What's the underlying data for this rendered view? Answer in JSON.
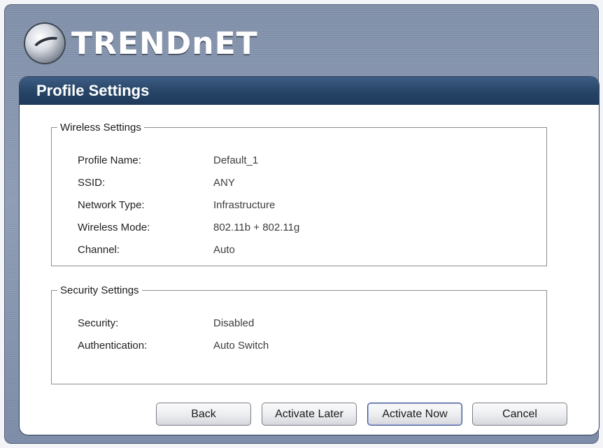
{
  "brand": {
    "logo_text": "TRENDnET"
  },
  "header": {
    "title": "Profile Settings"
  },
  "wireless": {
    "legend": "Wireless Settings",
    "rows": [
      {
        "label": "Profile Name:",
        "value": "Default_1"
      },
      {
        "label": "SSID:",
        "value": "ANY"
      },
      {
        "label": "Network Type:",
        "value": "Infrastructure"
      },
      {
        "label": "Wireless Mode:",
        "value": "802.11b + 802.11g"
      },
      {
        "label": "Channel:",
        "value": "Auto"
      }
    ]
  },
  "security": {
    "legend": "Security Settings",
    "rows": [
      {
        "label": "Security:",
        "value": "Disabled"
      },
      {
        "label": "Authentication:",
        "value": "Auto Switch"
      }
    ]
  },
  "buttons": {
    "back": "Back",
    "activate_later": "Activate Later",
    "activate_now": "Activate Now",
    "cancel": "Cancel"
  },
  "colors": {
    "header_bg": "#264466",
    "frame_bg": "#8392ab",
    "panel_bg": "#ffffff"
  }
}
